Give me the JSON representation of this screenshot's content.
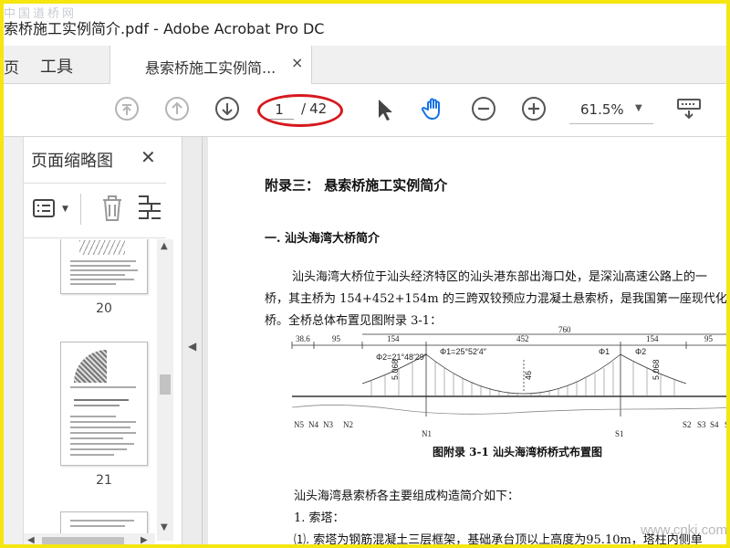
{
  "window": {
    "watermark": "中国道桥网",
    "title": "索桥施工实例简介.pdf - Adobe Acrobat Pro DC"
  },
  "tabs": {
    "home_label": "页",
    "tools_label": "工具",
    "doc_label": "悬索桥施工实例简...",
    "close_glyph": "×"
  },
  "toolbar": {
    "icons": [
      "first-page-icon",
      "previous-page-icon",
      "next-page-icon",
      "select-cursor-icon",
      "hand-tool-icon",
      "zoom-out-icon",
      "zoom-in-icon",
      "keyboard-icon"
    ],
    "current_page": "1",
    "page_separator": "/",
    "total_pages": "42",
    "zoom": "61.5%",
    "highlight_color": "#d6181e",
    "accent_color": "#1473e6"
  },
  "left_panel": {
    "title": "页面缩略图",
    "close_glyph": "✕",
    "thumbnails": [
      {
        "page_label": "20"
      },
      {
        "page_label": "21"
      }
    ]
  },
  "document": {
    "heading": "附录三：  悬索桥施工实例简介",
    "subheading": "一.  汕头海湾大桥简介",
    "paragraph": [
      "汕头海湾大桥位于汕头经济特区的汕头港东部出海口处，是深汕高速公路上的一",
      "桥，其主桥为 154+452+154m 的三跨双铰预应力混凝土悬索桥，是我国第一座现代化",
      "桥。全桥总体布置见图附录 3-1："
    ],
    "figure": {
      "dims": [
        "38.6",
        "95",
        "154",
        "452",
        "154",
        "95",
        "760"
      ],
      "slopes": [
        "Φ2=21°48′29″",
        "Φ1=25°52′4″",
        "Φ1",
        "Φ2"
      ],
      "heights": [
        "5.068",
        "46",
        "5.068"
      ],
      "piers": [
        "N5",
        "N4",
        "N3",
        "N2",
        "N1",
        "S1",
        "S2",
        "S3",
        "S4",
        "S5"
      ]
    },
    "caption": "图附录 3-1    汕头海湾桥桥式布置图",
    "body_lines": [
      "汕头海湾悬索桥各主要组成构造简介如下：",
      "1.  索塔：",
      "⑴.  索塔为钢筋混凝土三层框架，基础承台顶以上高度为95.10m，塔柱内侧单"
    ],
    "watermark": "www.cnki.com"
  }
}
